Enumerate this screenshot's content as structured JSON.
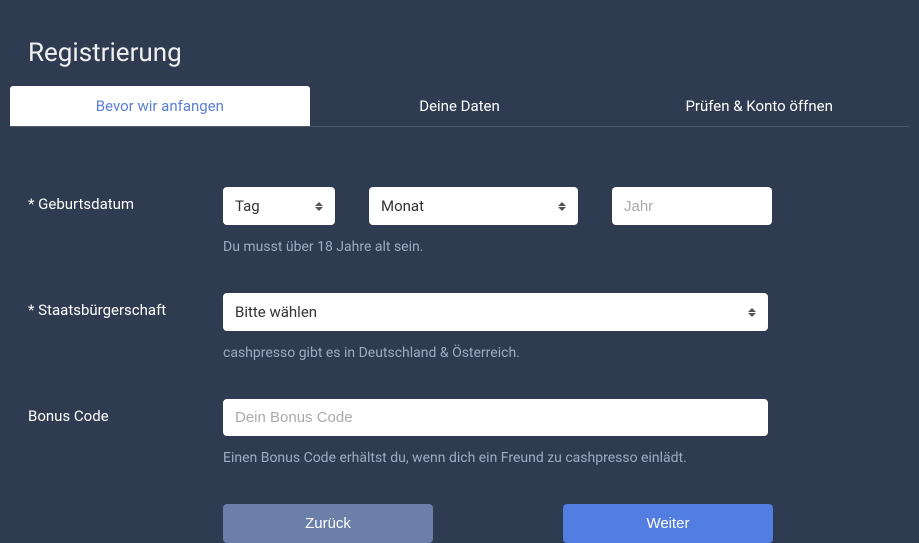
{
  "page": {
    "title": "Registrierung"
  },
  "tabs": {
    "step1": "Bevor wir anfangen",
    "step2": "Deine Daten",
    "step3": "Prüfen & Konto öffnen"
  },
  "form": {
    "birthdate": {
      "label": "* Geburtsdatum",
      "day_placeholder": "Tag",
      "month_placeholder": "Monat",
      "year_placeholder": "Jahr",
      "hint": "Du musst über 18 Jahre alt sein."
    },
    "citizenship": {
      "label": "* Staatsbürgerschaft",
      "placeholder": "Bitte wählen",
      "hint": "cashpresso gibt es in Deutschland & Österreich."
    },
    "bonus": {
      "label": "Bonus Code",
      "placeholder": "Dein Bonus Code",
      "hint": "Einen Bonus Code erhältst du, wenn dich ein Freund zu cashpresso einlädt."
    }
  },
  "buttons": {
    "back": "Zurück",
    "next": "Weiter"
  }
}
